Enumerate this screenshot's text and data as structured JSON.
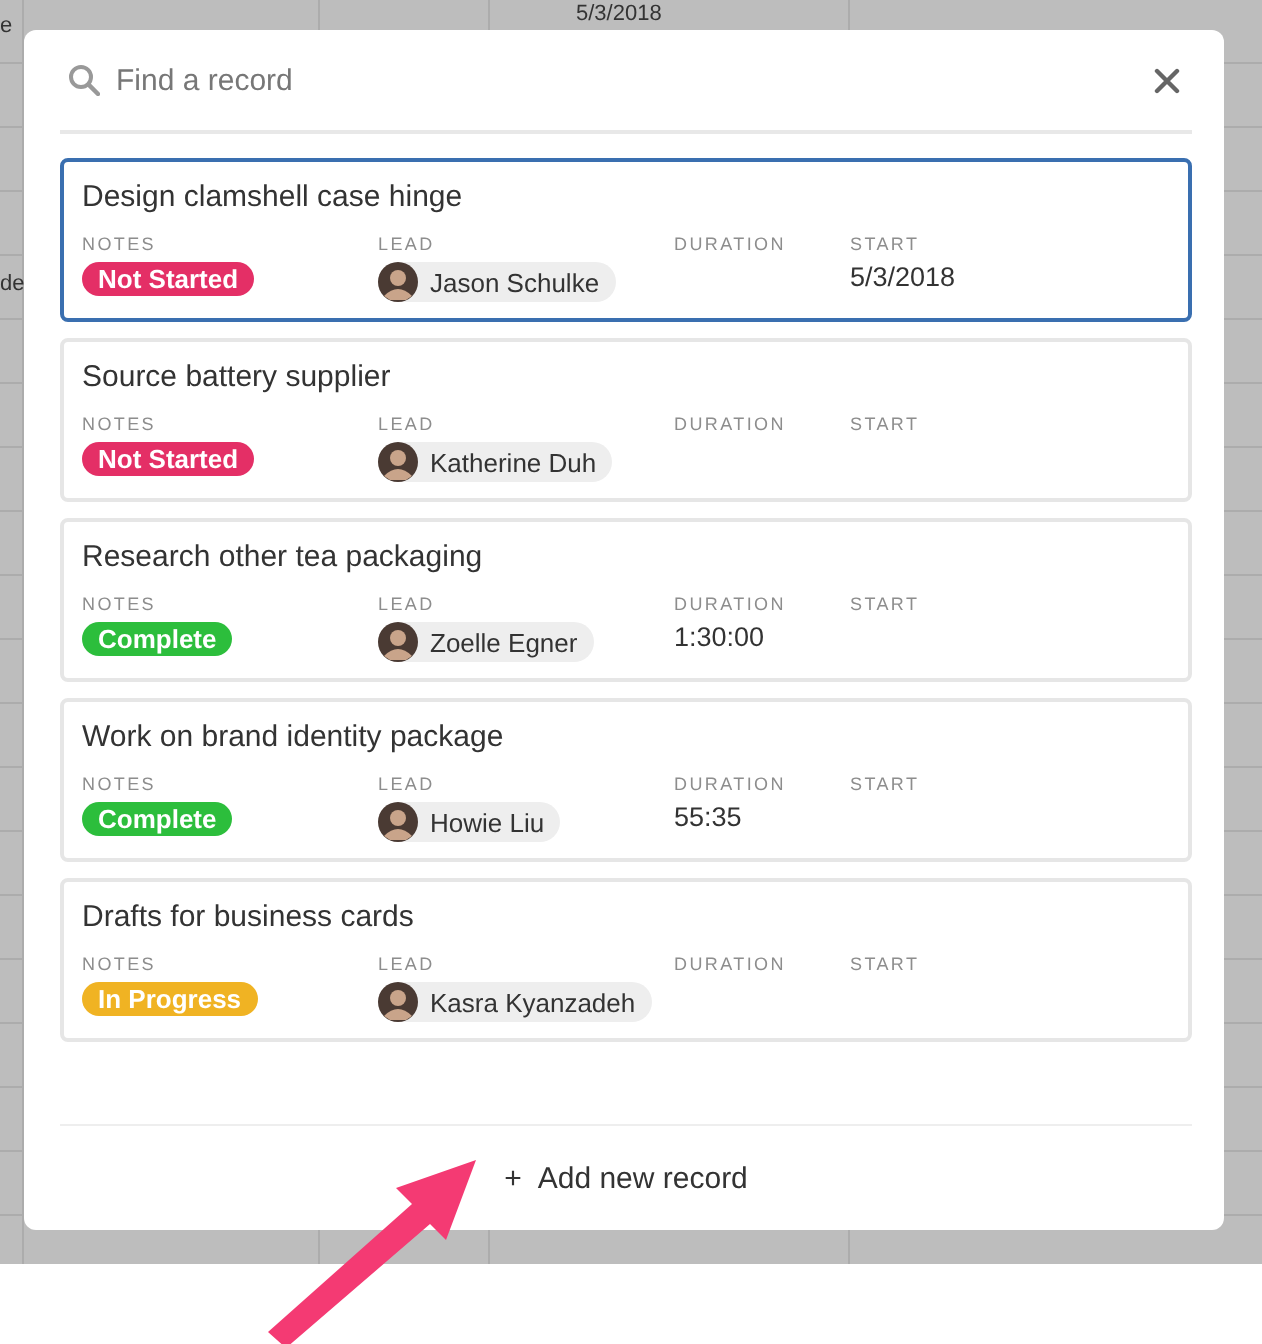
{
  "background_sheet": {
    "texts": [
      "e",
      "5/3/2018",
      "de"
    ]
  },
  "dialog": {
    "search": {
      "placeholder": "Find a record"
    },
    "records": [
      {
        "title": "Design clamshell case hinge",
        "selected": true,
        "notes": {
          "label": "NOTES",
          "status": "Not Started",
          "color": "#e42f66"
        },
        "lead": {
          "label": "LEAD",
          "name": "Jason Schulke"
        },
        "duration": {
          "label": "DURATION"
        },
        "start": {
          "label": "START",
          "value": "5/3/2018"
        }
      },
      {
        "title": "Source battery supplier",
        "selected": false,
        "notes": {
          "label": "NOTES",
          "status": "Not Started",
          "color": "#e42f66"
        },
        "lead": {
          "label": "LEAD",
          "name": "Katherine Duh"
        },
        "duration": {
          "label": "DURATION"
        },
        "start": {
          "label": "START"
        }
      },
      {
        "title": "Research other tea packaging",
        "selected": false,
        "notes": {
          "label": "NOTES",
          "status": "Complete",
          "color": "#2cbe3c"
        },
        "lead": {
          "label": "LEAD",
          "name": "Zoelle Egner"
        },
        "duration": {
          "label": "DURATION",
          "value": "1:30:00"
        },
        "start": {
          "label": "START"
        }
      },
      {
        "title": "Work on brand identity package",
        "selected": false,
        "notes": {
          "label": "NOTES",
          "status": "Complete",
          "color": "#2cbe3c"
        },
        "lead": {
          "label": "LEAD",
          "name": "Howie Liu"
        },
        "duration": {
          "label": "DURATION",
          "value": "55:35"
        },
        "start": {
          "label": "START"
        }
      },
      {
        "title": "Drafts for business cards",
        "selected": false,
        "notes": {
          "label": "NOTES",
          "status": "In Progress",
          "color": "#f0b323"
        },
        "lead": {
          "label": "LEAD",
          "name": "Kasra Kyanzadeh"
        },
        "duration": {
          "label": "DURATION"
        },
        "start": {
          "label": "START"
        }
      }
    ],
    "add_button": {
      "icon": "+",
      "label": "Add new record"
    }
  }
}
